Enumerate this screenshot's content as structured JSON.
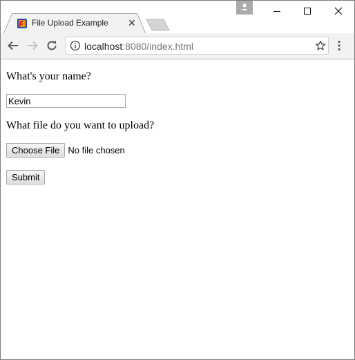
{
  "browser": {
    "tab_title": "File Upload Example",
    "tab_close": "✕",
    "url_host": "localhost",
    "url_rest": ":8080/index.html"
  },
  "form": {
    "name_question": "What's your name?",
    "name_value": "Kevin",
    "file_question": "What file do you want to upload?",
    "choose_file_label": "Choose File",
    "no_file_text": "No file chosen",
    "submit_label": "Submit"
  },
  "colors": {
    "favicon_bg": "#1f4fa8",
    "favicon_accent": "#e0241c"
  }
}
